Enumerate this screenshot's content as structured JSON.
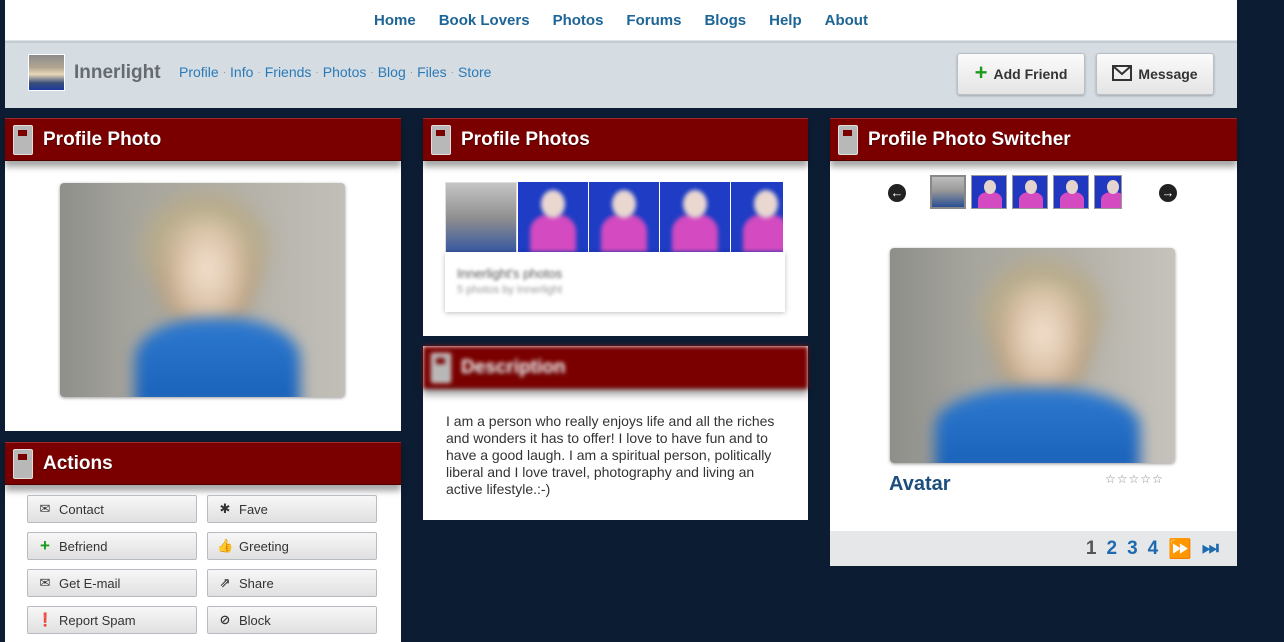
{
  "topnav": [
    "Home",
    "Book Lovers",
    "Photos",
    "Forums",
    "Blogs",
    "Help",
    "About"
  ],
  "user": {
    "name": "Innerlight",
    "links": [
      "Profile",
      "Info",
      "Friends",
      "Photos",
      "Blog",
      "Files",
      "Store"
    ],
    "add_friend": "Add Friend",
    "message": "Message"
  },
  "profile_photo": {
    "title": "Profile Photo"
  },
  "actions": {
    "title": "Actions",
    "buttons": [
      {
        "label": "Contact",
        "icon": "envelope-icon"
      },
      {
        "label": "Fave",
        "icon": "asterisk-icon"
      },
      {
        "label": "Befriend",
        "icon": "plus-icon"
      },
      {
        "label": "Greeting",
        "icon": "thumbs-up-icon"
      },
      {
        "label": "Get E-mail",
        "icon": "envelope-icon"
      },
      {
        "label": "Share",
        "icon": "share-icon"
      },
      {
        "label": "Report Spam",
        "icon": "exclamation-icon"
      },
      {
        "label": "Block",
        "icon": "block-icon"
      }
    ]
  },
  "profile_photos": {
    "title": "Profile Photos",
    "album_title": "Innerlight's photos",
    "album_subtitle": "5 photos by Innerlight"
  },
  "description": {
    "title": "Description",
    "text": "I am a person who really enjoys life and all the riches and wonders it has to offer! I love to have fun and to have a good laugh. I am a spiritual person, politically liberal and I love travel, photography and living an active lifestyle.:-)"
  },
  "switcher": {
    "title": "Profile Photo Switcher",
    "caption": "Avatar",
    "pages": [
      "1",
      "2",
      "3",
      "4"
    ],
    "current_page": "1"
  },
  "colors": {
    "panel_header": "#7a0000",
    "link": "#1d6596",
    "background": "#0c1d33"
  }
}
